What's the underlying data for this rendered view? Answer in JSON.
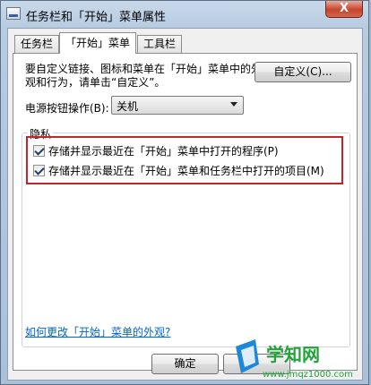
{
  "window": {
    "title": "任务栏和「开始」菜单属性",
    "close_label": "X"
  },
  "tabs": [
    {
      "label": "任务栏",
      "active": false
    },
    {
      "label": "「开始」菜单",
      "active": true
    },
    {
      "label": "工具栏",
      "active": false
    }
  ],
  "start_menu": {
    "description": "要自定义链接、图标和菜单在「开始」菜单中的外观和行为，请单击“自定义”。",
    "customize_label": "自定义(C)...",
    "power_label": "电源按钮操作(B):",
    "power_value": "关机",
    "privacy_group_label": "隐私",
    "checkboxes": [
      {
        "label": "存储并显示最近在「开始」菜单中打开的程序(P)",
        "checked": true
      },
      {
        "label": "存储并显示最近在「开始」菜单和任务栏中打开的项目(M)",
        "checked": true
      }
    ],
    "help_link": "如何更改「开始」菜单的外观?"
  },
  "buttons": {
    "ok_label": "确定"
  },
  "watermark": {
    "brand": "学知网",
    "url": "www.jmqz1000.com"
  },
  "colors": {
    "highlight_border": "#c2252f",
    "link": "#0066cc",
    "watermark_green": "#22a33a"
  }
}
